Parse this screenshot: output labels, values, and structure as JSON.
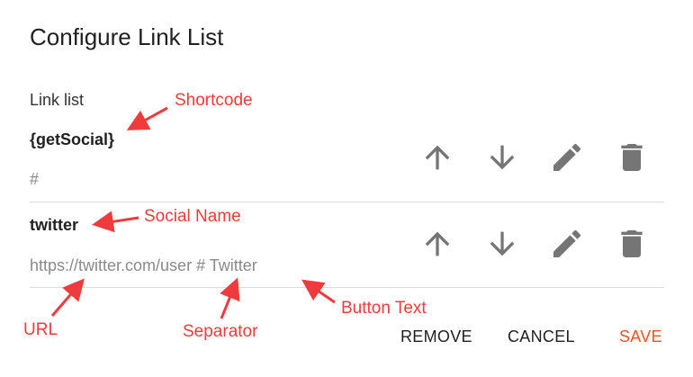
{
  "dialog": {
    "title": "Configure Link List",
    "section_label": "Link list"
  },
  "rows": [
    {
      "name": "{getSocial}",
      "value": "#"
    },
    {
      "name": "twitter",
      "value": "https://twitter.com/user # Twitter"
    }
  ],
  "row_icons": [
    "arrow-up-icon",
    "arrow-down-icon",
    "pencil-icon",
    "trash-icon"
  ],
  "actions": {
    "remove": "REMOVE",
    "cancel": "CANCEL",
    "save": "SAVE"
  },
  "annotations": {
    "shortcode": "Shortcode",
    "social_name": "Social Name",
    "url": "URL",
    "separator": "Separator",
    "button_text": "Button Text"
  },
  "colors": {
    "accent": "#f4511e",
    "annotation": "#ef3b3b",
    "icon": "#757575",
    "divider": "#dcdcdc"
  }
}
